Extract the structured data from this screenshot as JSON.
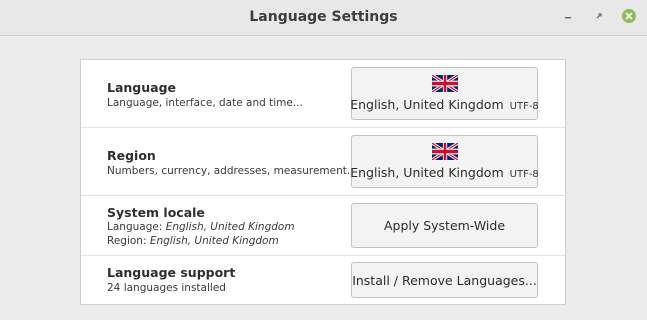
{
  "window": {
    "title": "Language Settings"
  },
  "rows": [
    {
      "title": "Language",
      "subtitle": "Language, interface, date and time...",
      "button_label": "English, United Kingdom",
      "button_encoding": "UTF-8",
      "button_icon": "uk-flag-icon"
    },
    {
      "title": "Region",
      "subtitle": "Numbers, currency, addresses, measurement...",
      "button_label": "English, United Kingdom",
      "button_encoding": "UTF-8",
      "button_icon": "uk-flag-icon"
    },
    {
      "title": "System locale",
      "line1_prefix": "Language: ",
      "line1_value": "English, United Kingdom",
      "line2_prefix": "Region: ",
      "line2_value": "English, United Kingdom",
      "button_label": "Apply System-Wide"
    },
    {
      "title": "Language support",
      "subtitle": "24 languages installed",
      "button_label": "Install / Remove Languages..."
    }
  ],
  "colors": {
    "close_button": "#8cbd58",
    "flag_blue": "#012169",
    "flag_red": "#c8102e"
  }
}
